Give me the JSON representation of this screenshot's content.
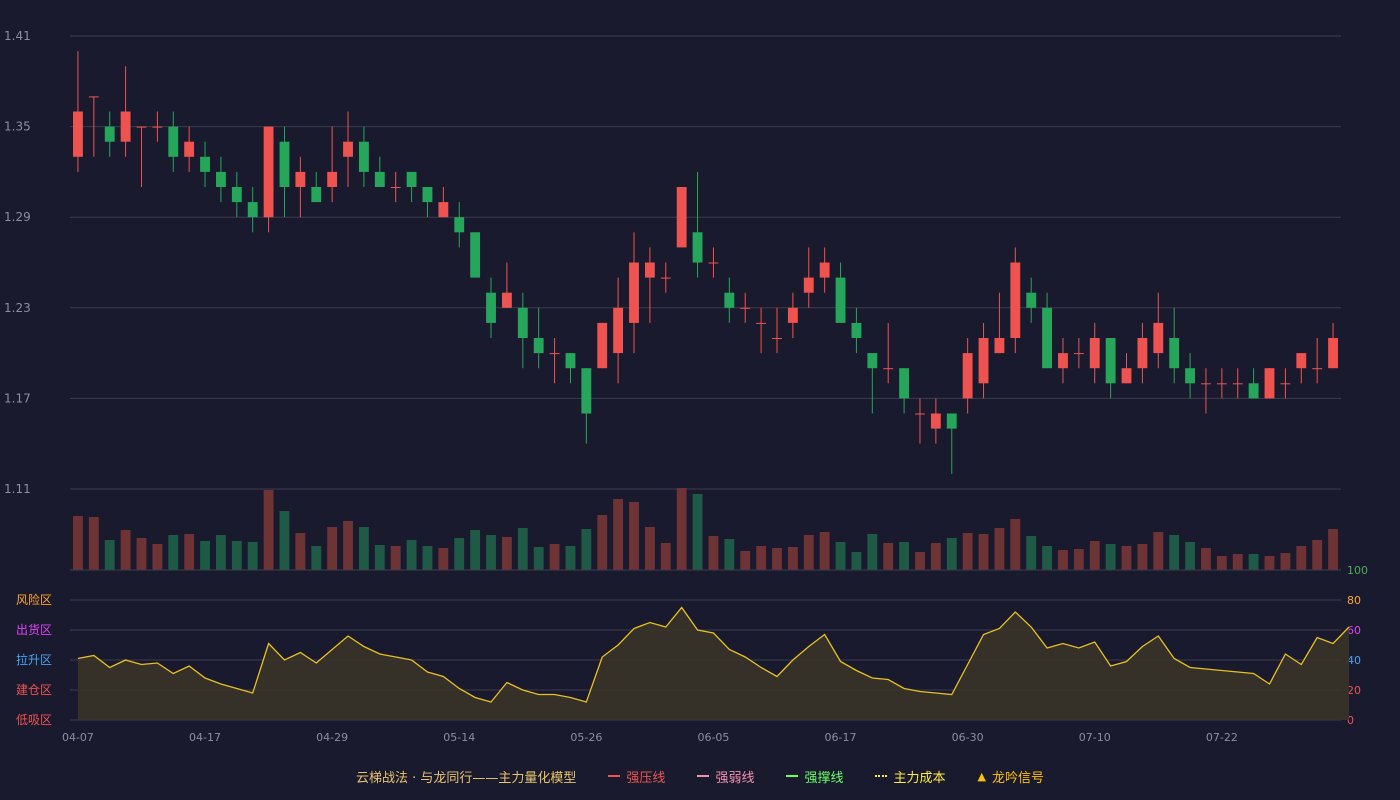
{
  "chart_data": {
    "type": "candlestick",
    "price_axis": {
      "ylim": [
        1.11,
        1.41
      ],
      "ticks": [
        "1.41",
        "1.35",
        "1.29",
        "1.23",
        "1.17",
        "1.11"
      ]
    },
    "osc_axis": {
      "ylim": [
        0,
        100
      ],
      "ticks": [
        "100",
        "80",
        "60",
        "40",
        "20",
        "0"
      ]
    },
    "zones": [
      {
        "label": "风险区",
        "level": 80,
        "color": "#ffa726"
      },
      {
        "label": "出货区",
        "level": 60,
        "color": "#e040fb"
      },
      {
        "label": "拉升区",
        "level": 40,
        "color": "#42a5f5"
      },
      {
        "label": "建仓区",
        "level": 20,
        "color": "#ef5350"
      },
      {
        "label": "低吸区",
        "level": 0,
        "color": "#ef5350"
      }
    ],
    "x_ticks": [
      {
        "i": 0,
        "label": "04-07"
      },
      {
        "i": 8,
        "label": "04-17"
      },
      {
        "i": 16,
        "label": "04-29"
      },
      {
        "i": 24,
        "label": "05-14"
      },
      {
        "i": 32,
        "label": "05-26"
      },
      {
        "i": 40,
        "label": "06-05"
      },
      {
        "i": 48,
        "label": "06-17"
      },
      {
        "i": 56,
        "label": "06-30"
      },
      {
        "i": 64,
        "label": "07-10"
      },
      {
        "i": 72,
        "label": "07-22"
      }
    ],
    "candles": [
      {
        "o": 1.33,
        "h": 1.4,
        "l": 1.32,
        "c": 1.36
      },
      {
        "o": 1.37,
        "h": 1.37,
        "l": 1.33,
        "c": 1.37
      },
      {
        "o": 1.35,
        "h": 1.36,
        "l": 1.33,
        "c": 1.34
      },
      {
        "o": 1.34,
        "h": 1.39,
        "l": 1.33,
        "c": 1.36
      },
      {
        "o": 1.35,
        "h": 1.35,
        "l": 1.31,
        "c": 1.35
      },
      {
        "o": 1.35,
        "h": 1.36,
        "l": 1.34,
        "c": 1.35
      },
      {
        "o": 1.35,
        "h": 1.36,
        "l": 1.32,
        "c": 1.33
      },
      {
        "o": 1.33,
        "h": 1.35,
        "l": 1.32,
        "c": 1.34
      },
      {
        "o": 1.33,
        "h": 1.34,
        "l": 1.31,
        "c": 1.32
      },
      {
        "o": 1.32,
        "h": 1.33,
        "l": 1.3,
        "c": 1.31
      },
      {
        "o": 1.31,
        "h": 1.32,
        "l": 1.29,
        "c": 1.3
      },
      {
        "o": 1.3,
        "h": 1.31,
        "l": 1.28,
        "c": 1.29
      },
      {
        "o": 1.29,
        "h": 1.35,
        "l": 1.28,
        "c": 1.35
      },
      {
        "o": 1.34,
        "h": 1.35,
        "l": 1.29,
        "c": 1.31
      },
      {
        "o": 1.31,
        "h": 1.33,
        "l": 1.29,
        "c": 1.32
      },
      {
        "o": 1.31,
        "h": 1.32,
        "l": 1.3,
        "c": 1.3
      },
      {
        "o": 1.31,
        "h": 1.35,
        "l": 1.3,
        "c": 1.32
      },
      {
        "o": 1.33,
        "h": 1.36,
        "l": 1.31,
        "c": 1.34
      },
      {
        "o": 1.34,
        "h": 1.35,
        "l": 1.31,
        "c": 1.32
      },
      {
        "o": 1.32,
        "h": 1.33,
        "l": 1.31,
        "c": 1.31
      },
      {
        "o": 1.31,
        "h": 1.32,
        "l": 1.3,
        "c": 1.31
      },
      {
        "o": 1.32,
        "h": 1.32,
        "l": 1.3,
        "c": 1.31
      },
      {
        "o": 1.31,
        "h": 1.31,
        "l": 1.29,
        "c": 1.3
      },
      {
        "o": 1.29,
        "h": 1.31,
        "l": 1.29,
        "c": 1.3
      },
      {
        "o": 1.29,
        "h": 1.3,
        "l": 1.27,
        "c": 1.28
      },
      {
        "o": 1.28,
        "h": 1.28,
        "l": 1.25,
        "c": 1.25
      },
      {
        "o": 1.24,
        "h": 1.25,
        "l": 1.21,
        "c": 1.22
      },
      {
        "o": 1.23,
        "h": 1.26,
        "l": 1.23,
        "c": 1.24
      },
      {
        "o": 1.23,
        "h": 1.24,
        "l": 1.19,
        "c": 1.21
      },
      {
        "o": 1.21,
        "h": 1.23,
        "l": 1.19,
        "c": 1.2
      },
      {
        "o": 1.2,
        "h": 1.21,
        "l": 1.18,
        "c": 1.2
      },
      {
        "o": 1.2,
        "h": 1.2,
        "l": 1.18,
        "c": 1.19
      },
      {
        "o": 1.19,
        "h": 1.19,
        "l": 1.14,
        "c": 1.16
      },
      {
        "o": 1.19,
        "h": 1.22,
        "l": 1.19,
        "c": 1.22
      },
      {
        "o": 1.2,
        "h": 1.25,
        "l": 1.18,
        "c": 1.23
      },
      {
        "o": 1.22,
        "h": 1.28,
        "l": 1.2,
        "c": 1.26
      },
      {
        "o": 1.25,
        "h": 1.27,
        "l": 1.22,
        "c": 1.26
      },
      {
        "o": 1.25,
        "h": 1.26,
        "l": 1.24,
        "c": 1.25
      },
      {
        "o": 1.27,
        "h": 1.31,
        "l": 1.27,
        "c": 1.31
      },
      {
        "o": 1.28,
        "h": 1.32,
        "l": 1.25,
        "c": 1.26
      },
      {
        "o": 1.26,
        "h": 1.27,
        "l": 1.25,
        "c": 1.26
      },
      {
        "o": 1.24,
        "h": 1.25,
        "l": 1.22,
        "c": 1.23
      },
      {
        "o": 1.23,
        "h": 1.24,
        "l": 1.22,
        "c": 1.23
      },
      {
        "o": 1.22,
        "h": 1.23,
        "l": 1.2,
        "c": 1.22
      },
      {
        "o": 1.21,
        "h": 1.23,
        "l": 1.2,
        "c": 1.21
      },
      {
        "o": 1.22,
        "h": 1.24,
        "l": 1.21,
        "c": 1.23
      },
      {
        "o": 1.24,
        "h": 1.27,
        "l": 1.23,
        "c": 1.25
      },
      {
        "o": 1.25,
        "h": 1.27,
        "l": 1.24,
        "c": 1.26
      },
      {
        "o": 1.25,
        "h": 1.26,
        "l": 1.22,
        "c": 1.22
      },
      {
        "o": 1.22,
        "h": 1.23,
        "l": 1.2,
        "c": 1.21
      },
      {
        "o": 1.2,
        "h": 1.2,
        "l": 1.16,
        "c": 1.19
      },
      {
        "o": 1.19,
        "h": 1.22,
        "l": 1.18,
        "c": 1.19
      },
      {
        "o": 1.19,
        "h": 1.19,
        "l": 1.16,
        "c": 1.17
      },
      {
        "o": 1.16,
        "h": 1.17,
        "l": 1.14,
        "c": 1.16
      },
      {
        "o": 1.15,
        "h": 1.17,
        "l": 1.14,
        "c": 1.16
      },
      {
        "o": 1.16,
        "h": 1.16,
        "l": 1.12,
        "c": 1.15
      },
      {
        "o": 1.17,
        "h": 1.21,
        "l": 1.16,
        "c": 1.2
      },
      {
        "o": 1.18,
        "h": 1.22,
        "l": 1.17,
        "c": 1.21
      },
      {
        "o": 1.2,
        "h": 1.24,
        "l": 1.2,
        "c": 1.21
      },
      {
        "o": 1.21,
        "h": 1.27,
        "l": 1.2,
        "c": 1.26
      },
      {
        "o": 1.24,
        "h": 1.25,
        "l": 1.22,
        "c": 1.23
      },
      {
        "o": 1.23,
        "h": 1.24,
        "l": 1.19,
        "c": 1.19
      },
      {
        "o": 1.19,
        "h": 1.21,
        "l": 1.18,
        "c": 1.2
      },
      {
        "o": 1.2,
        "h": 1.21,
        "l": 1.19,
        "c": 1.2
      },
      {
        "o": 1.19,
        "h": 1.22,
        "l": 1.18,
        "c": 1.21
      },
      {
        "o": 1.21,
        "h": 1.21,
        "l": 1.17,
        "c": 1.18
      },
      {
        "o": 1.18,
        "h": 1.2,
        "l": 1.18,
        "c": 1.19
      },
      {
        "o": 1.19,
        "h": 1.22,
        "l": 1.18,
        "c": 1.21
      },
      {
        "o": 1.2,
        "h": 1.24,
        "l": 1.19,
        "c": 1.22
      },
      {
        "o": 1.21,
        "h": 1.23,
        "l": 1.18,
        "c": 1.19
      },
      {
        "o": 1.19,
        "h": 1.2,
        "l": 1.17,
        "c": 1.18
      },
      {
        "o": 1.18,
        "h": 1.19,
        "l": 1.16,
        "c": 1.18
      },
      {
        "o": 1.18,
        "h": 1.19,
        "l": 1.17,
        "c": 1.18
      },
      {
        "o": 1.18,
        "h": 1.19,
        "l": 1.17,
        "c": 1.18
      },
      {
        "o": 1.18,
        "h": 1.19,
        "l": 1.17,
        "c": 1.17
      },
      {
        "o": 1.17,
        "h": 1.19,
        "l": 1.17,
        "c": 1.19
      },
      {
        "o": 1.18,
        "h": 1.19,
        "l": 1.17,
        "c": 1.18
      },
      {
        "o": 1.19,
        "h": 1.2,
        "l": 1.18,
        "c": 1.2
      },
      {
        "o": 1.19,
        "h": 1.21,
        "l": 1.18,
        "c": 1.19
      },
      {
        "o": 1.19,
        "h": 1.22,
        "l": 1.19,
        "c": 1.21
      }
    ],
    "volumes": [
      54,
      53,
      30,
      40,
      32,
      26,
      35,
      36,
      29,
      35,
      29,
      28,
      80,
      59,
      37,
      24,
      43,
      49,
      43,
      25,
      24,
      30,
      24,
      22,
      32,
      40,
      35,
      33,
      42,
      23,
      26,
      24,
      41,
      55,
      71,
      68,
      43,
      27,
      82,
      76,
      34,
      31,
      19,
      24,
      22,
      23,
      35,
      38,
      28,
      18,
      36,
      27,
      28,
      18,
      27,
      32,
      37,
      36,
      42,
      51,
      34,
      24,
      20,
      21,
      29,
      26,
      24,
      26,
      38,
      35,
      28,
      22,
      14,
      16,
      16,
      14,
      17,
      24,
      30,
      41
    ],
    "osc": [
      41,
      43,
      35,
      40,
      37,
      38,
      31,
      36,
      28,
      24,
      21,
      18,
      51,
      40,
      45,
      38,
      47,
      56,
      49,
      44,
      42,
      40,
      32,
      29,
      21,
      15,
      12,
      25,
      20,
      17,
      17,
      15,
      12,
      42,
      50,
      61,
      65,
      62,
      75,
      60,
      58,
      47,
      42,
      35,
      29,
      40,
      49,
      57,
      39,
      33,
      28,
      27,
      21,
      19,
      18,
      17,
      37,
      57,
      61,
      72,
      62,
      48,
      51,
      48,
      52,
      36,
      39,
      49,
      56,
      41,
      35,
      34,
      33,
      32,
      31,
      24,
      44,
      37,
      55,
      51,
      62
    ]
  },
  "legend": [
    {
      "label": "云梯战法 · 与龙同行——主力量化模型",
      "color": "#e8c46a",
      "kind": "text"
    },
    {
      "label": "强压线",
      "color": "#ef5350",
      "kind": "solid"
    },
    {
      "label": "强弱线",
      "color": "#f48fb1",
      "kind": "dashed"
    },
    {
      "label": "强撑线",
      "color": "#66ff66",
      "kind": "solid"
    },
    {
      "label": "主力成本",
      "color": "#ffeb3b",
      "kind": "dotted"
    },
    {
      "label": "龙吟信号",
      "color": "#ffc107",
      "kind": "triangle"
    }
  ],
  "colors": {
    "up": "#ef5350",
    "down": "#26a65b",
    "vol_up": "#6e3334",
    "vol_down": "#1e5a45",
    "osc_line": "#e8c020",
    "osc_fill": "#3a3428",
    "grid": "#3a3d4e",
    "axis_text": "#8a8ea0",
    "osc_max_tick": "#4caf50"
  }
}
